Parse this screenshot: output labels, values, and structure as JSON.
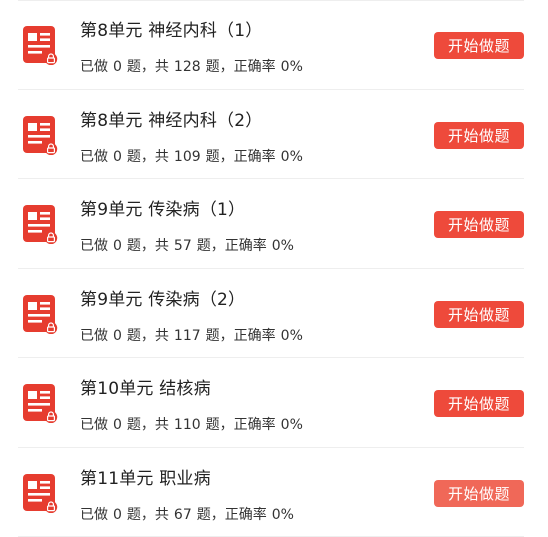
{
  "labels": {
    "done_prefix": "已做",
    "done_suffix": "题，共",
    "total_suffix": "题，正确率",
    "start_button": "开始做题"
  },
  "units": [
    {
      "title": "第8单元 神经内科（1）",
      "done": "0",
      "total": "128",
      "accuracy": "0%"
    },
    {
      "title": "第8单元 神经内科（2）",
      "done": "0",
      "total": "109",
      "accuracy": "0%"
    },
    {
      "title": "第9单元 传染病（1）",
      "done": "0",
      "total": "57",
      "accuracy": "0%"
    },
    {
      "title": "第9单元 传染病（2）",
      "done": "0",
      "total": "117",
      "accuracy": "0%"
    },
    {
      "title": "第10单元 结核病",
      "done": "0",
      "total": "110",
      "accuracy": "0%"
    },
    {
      "title": "第11单元 职业病",
      "done": "0",
      "total": "67",
      "accuracy": "0%"
    }
  ],
  "colors": {
    "accent": "#ee4a3b",
    "icon_red": "#e63c2f",
    "divider": "#eeeeee"
  },
  "icon": "locked-exam-paper-icon"
}
